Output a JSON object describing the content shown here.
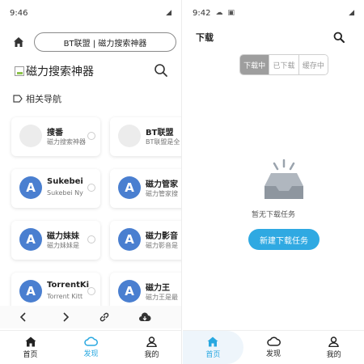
{
  "left": {
    "status_time": "9:46",
    "url_text": "BT联盟 | 磁力搜索神器",
    "site_title": "磁力搜索神器",
    "section_title": "相关导航",
    "cards": [
      {
        "title": "搜番",
        "desc": "磁力搜索神器"
      },
      {
        "title": "BT联盟",
        "desc": "BT联盟是全"
      },
      {
        "title": "Sukebei",
        "desc": "Sukebei Ny"
      },
      {
        "title": "磁力管家",
        "desc": "磁力管家搜"
      },
      {
        "title": "磁力妹妹",
        "desc": "磁力妹妹是"
      },
      {
        "title": "磁力影音",
        "desc": "磁力影音是"
      },
      {
        "title": "TorrentKi",
        "desc": "Torrent Kitt"
      },
      {
        "title": "磁力王",
        "desc": "磁力王是最"
      }
    ],
    "avatar_letter": "A",
    "tabs": [
      {
        "label": "首页",
        "icon": "home-icon"
      },
      {
        "label": "发现",
        "icon": "cloud-icon"
      },
      {
        "label": "我的",
        "icon": "person-icon"
      }
    ],
    "active_tab": "发现"
  },
  "right": {
    "status_time": "9:42",
    "title": "下载",
    "segments": [
      "下载中",
      "已下载",
      "缓存中"
    ],
    "active_segment": "下载中",
    "empty_text": "暂无下载任务",
    "new_task_button": "新建下载任务",
    "tabs": [
      {
        "label": "首页",
        "icon": "home-icon"
      },
      {
        "label": "发现",
        "icon": "cloud-icon"
      },
      {
        "label": "我的",
        "icon": "person-icon"
      }
    ],
    "active_tab": "首页"
  },
  "colors": {
    "accent": "#2fa9e2",
    "avatar_blue": "#4a7fd0",
    "segment_active": "#9e9e9e"
  }
}
